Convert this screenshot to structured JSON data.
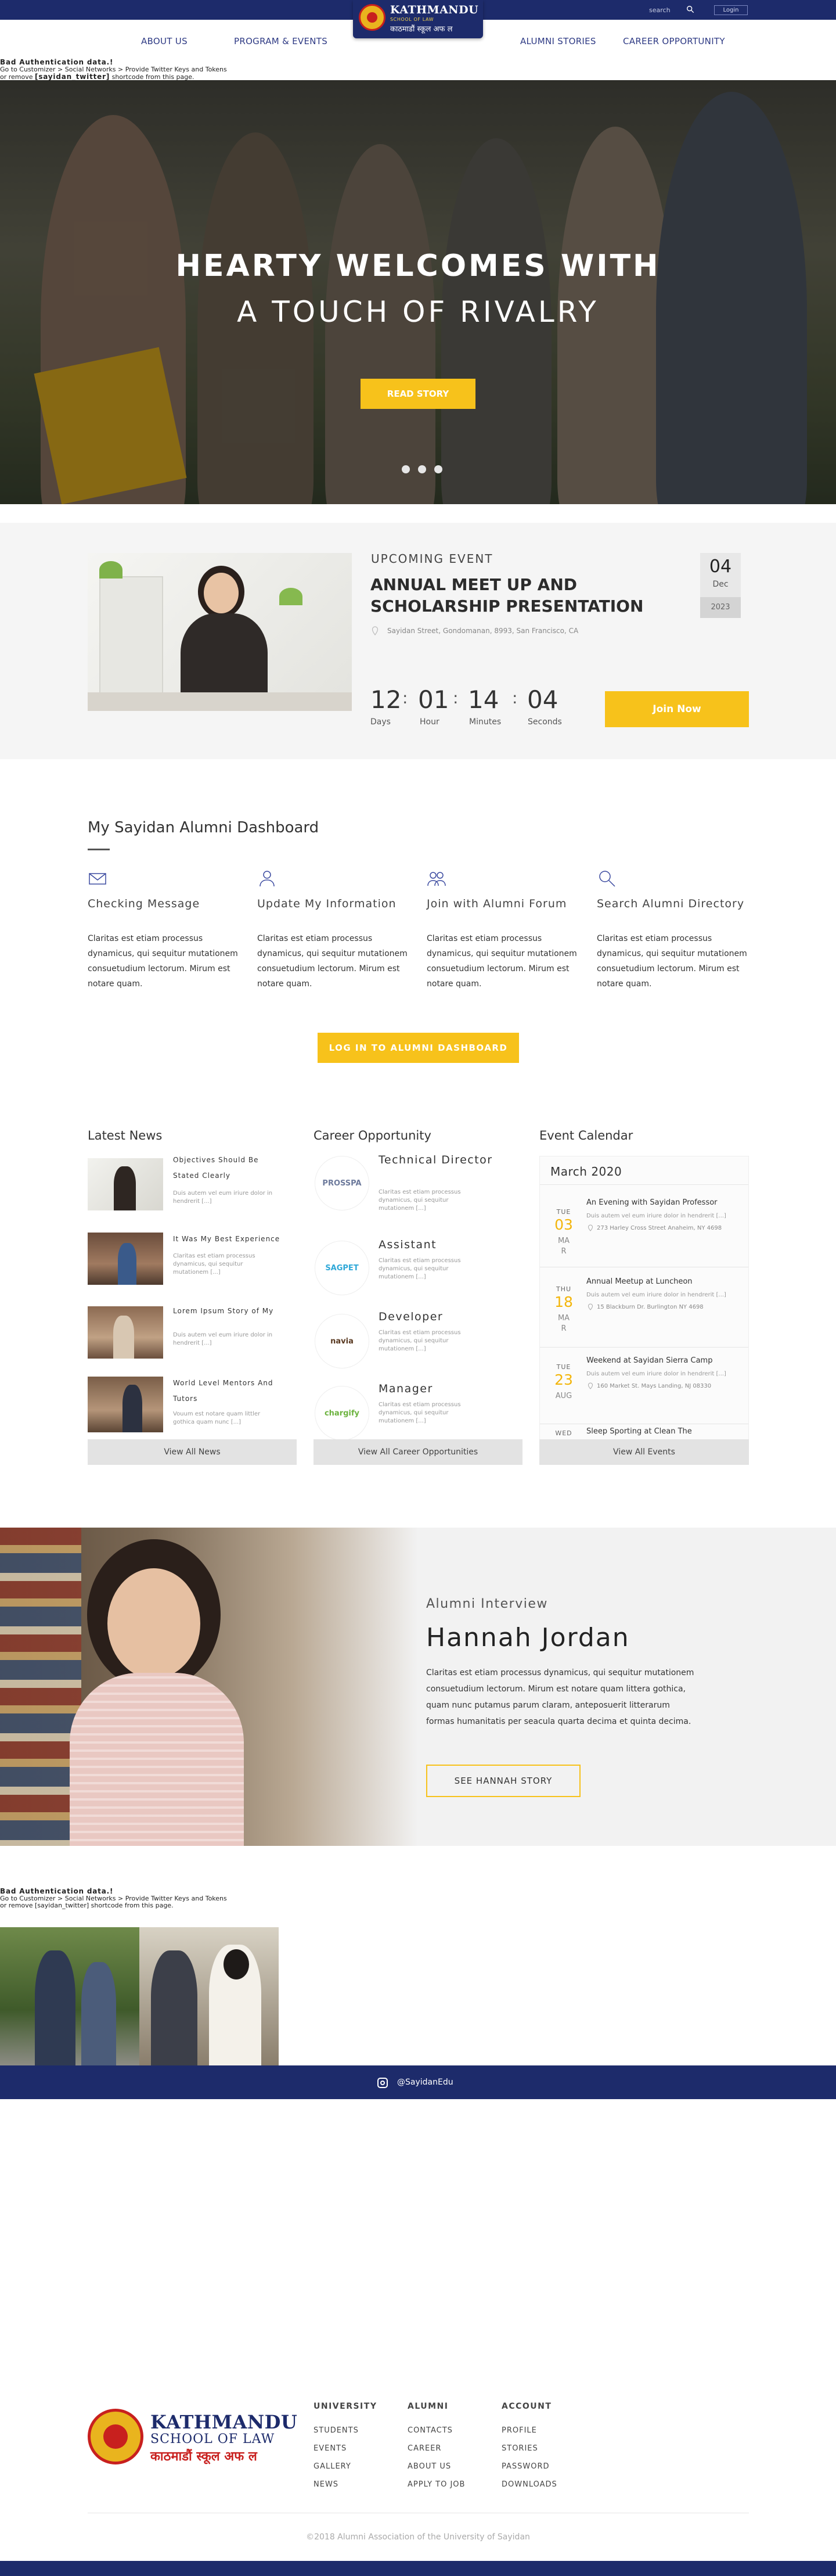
{
  "colors": {
    "navy": "#1d2b6b",
    "accent": "#f7c21b",
    "event_date": "#f3b50b"
  },
  "topbar": {
    "search_label": "search",
    "login_label": "Login"
  },
  "logo": {
    "name": "KATHMANDU",
    "tagline": "SCHOOL OF LAW",
    "nepali": "काठमाडौं स्कूल अफ ल"
  },
  "nav": {
    "items": [
      "ABOUT US",
      "PROGRAM & EVENTS",
      "ALUMNI STORIES",
      "CAREER OPPORTUNITY"
    ]
  },
  "twitter_error": {
    "heading": "Bad Authentication data.!",
    "line1": "Go to Customizer > Social Networks > Provide Twitter Keys and Tokens",
    "line2_prefix": "or remove ",
    "line2_code": "[sayidan_twitter]",
    "line2_suffix": " shortcode from this page."
  },
  "hero": {
    "line1": "HEARTY WELCOMES WITH",
    "line2": "A TOUCH OF RIVALRY",
    "button": "READ STORY",
    "slides": 3
  },
  "event": {
    "label": "UPCOMING EVENT",
    "title": "ANNUAL MEET UP AND SCHOLARSHIP PRESENTATION",
    "address": "Sayidan Street, Gondomanan, 8993, San Francisco, CA",
    "date": {
      "day": "04",
      "month": "Dec",
      "year": "2023"
    },
    "countdown": [
      {
        "value": "12",
        "label": "Days"
      },
      {
        "value": "01",
        "label": "Hour"
      },
      {
        "value": "14",
        "label": "Minutes"
      },
      {
        "value": "04",
        "label": "Seconds"
      }
    ],
    "join_button": "Join Now"
  },
  "dashboard": {
    "title": "My Sayidan Alumni Dashboard",
    "features": [
      {
        "icon": "envelope-icon",
        "title": "Checking Message",
        "text": "Claritas est etiam processus dynamicus, qui sequitur mutationem consuetudium lectorum. Mirum est notare quam."
      },
      {
        "icon": "user-icon",
        "title": "Update My Information",
        "text": "Claritas est etiam processus dynamicus, qui sequitur mutationem consuetudium lectorum. Mirum est notare quam."
      },
      {
        "icon": "users-icon",
        "title": "Join with Alumni Forum",
        "text": "Claritas est etiam processus dynamicus, qui sequitur mutationem consuetudium lectorum. Mirum est notare quam."
      },
      {
        "icon": "search-icon",
        "title": "Search Alumni Directory",
        "text": "Claritas est etiam processus dynamicus, qui sequitur mutationem consuetudium lectorum. Mirum est notare quam."
      }
    ],
    "login_button": "LOG IN TO ALUMNI DASHBOARD"
  },
  "news": {
    "heading": "Latest News",
    "items": [
      {
        "title": "Objectives Should Be Stated Clearly",
        "text": "Duis autem vel eum iriure dolor in hendrerit [...]"
      },
      {
        "title": "It Was My Best Experience",
        "text": "Claritas est etiam processus dynamicus, qui sequitur mutationem [...]"
      },
      {
        "title": "Lorem Ipsum Story of My",
        "text": "Duis autem vel eum iriure dolor in hendrerit [...]"
      },
      {
        "title": "World Level Mentors And Tutors",
        "text": "Vouum est notare quam littler gothica quam nunc [...]"
      }
    ],
    "view_all": "View All News"
  },
  "career": {
    "heading": "Career Opportunity",
    "items": [
      {
        "logo": "PROSSPA",
        "logo_color": "#6d7a9c",
        "title": "Technical Director",
        "text": "Claritas est etiam processus dynamicus, qui sequitur mutationem [...]"
      },
      {
        "logo": "SAGPET",
        "logo_color": "#2fa8d8",
        "title": "Assistant",
        "text": "Claritas est etiam processus dynamicus, qui sequitur mutationem [...]"
      },
      {
        "logo": "navia",
        "logo_color": "#5a3a22",
        "title": "Developer",
        "text": "Claritas est etiam processus dynamicus, qui sequitur mutationem [...]"
      },
      {
        "logo": "chargify",
        "logo_color": "#6cb33f",
        "title": "Manager",
        "text": "Claritas est etiam processus dynamicus, qui sequitur mutationem [...]"
      }
    ],
    "view_all": "View All Career Opportunities"
  },
  "calendar": {
    "heading": "Event Calendar",
    "month": "March 2020",
    "events": [
      {
        "weekday": "TUE",
        "date": "03",
        "month": "MA",
        "extra": "R",
        "title": "An Evening with Sayidan Professor",
        "text": "Duis autem vel eum iriure dolor in hendrerit [...]",
        "address": "273 Harley Cross Street Anaheim, NY 4698"
      },
      {
        "weekday": "THU",
        "date": "18",
        "month": "MA",
        "extra": "R",
        "title": "Annual Meetup at Luncheon",
        "text": "Duis autem vel eum iriure dolor in hendrerit [...]",
        "address": "15 Blackburn Dr. Burlington NY 4698"
      },
      {
        "weekday": "TUE",
        "date": "23",
        "month": "AUG",
        "extra": "",
        "title": "Weekend at Sayidan Sierra Camp",
        "text": "Duis autem vel eum iriure dolor in hendrerit [...]",
        "address": "160 Market St. Mays Landing, NJ 08330"
      },
      {
        "weekday": "WED",
        "date": "",
        "month": "",
        "extra": "",
        "title": "Sleep Sporting at Clean The",
        "text": "",
        "address": ""
      }
    ],
    "view_all": "View All Events"
  },
  "interview": {
    "label": "Alumni Interview",
    "name": "Hannah Jordan",
    "text": "Claritas est etiam processus dynamicus, qui sequitur mutationem consuetudium lectorum. Mirum est notare quam littera gothica, quam nunc putamus parum claram, anteposuerit litterarum formas humanitatis per seacula quarta decima et quinta decima.",
    "button": "SEE HANNAH STORY"
  },
  "instagram": {
    "handle": "@SayidanEdu"
  },
  "footer": {
    "columns": [
      {
        "heading": "UNIVERSITY",
        "links": [
          "STUDENTS",
          "EVENTS",
          "GALLERY",
          "NEWS"
        ]
      },
      {
        "heading": "ALUMNI",
        "links": [
          "CONTACTS",
          "CAREER",
          "ABOUT US",
          "APPLY TO JOB"
        ]
      },
      {
        "heading": "ACCOUNT",
        "links": [
          "PROFILE",
          "STORIES",
          "PASSWORD",
          "DOWNLOADS"
        ]
      }
    ],
    "copyright": "©2018 Alumni Association of the University of Sayidan"
  }
}
